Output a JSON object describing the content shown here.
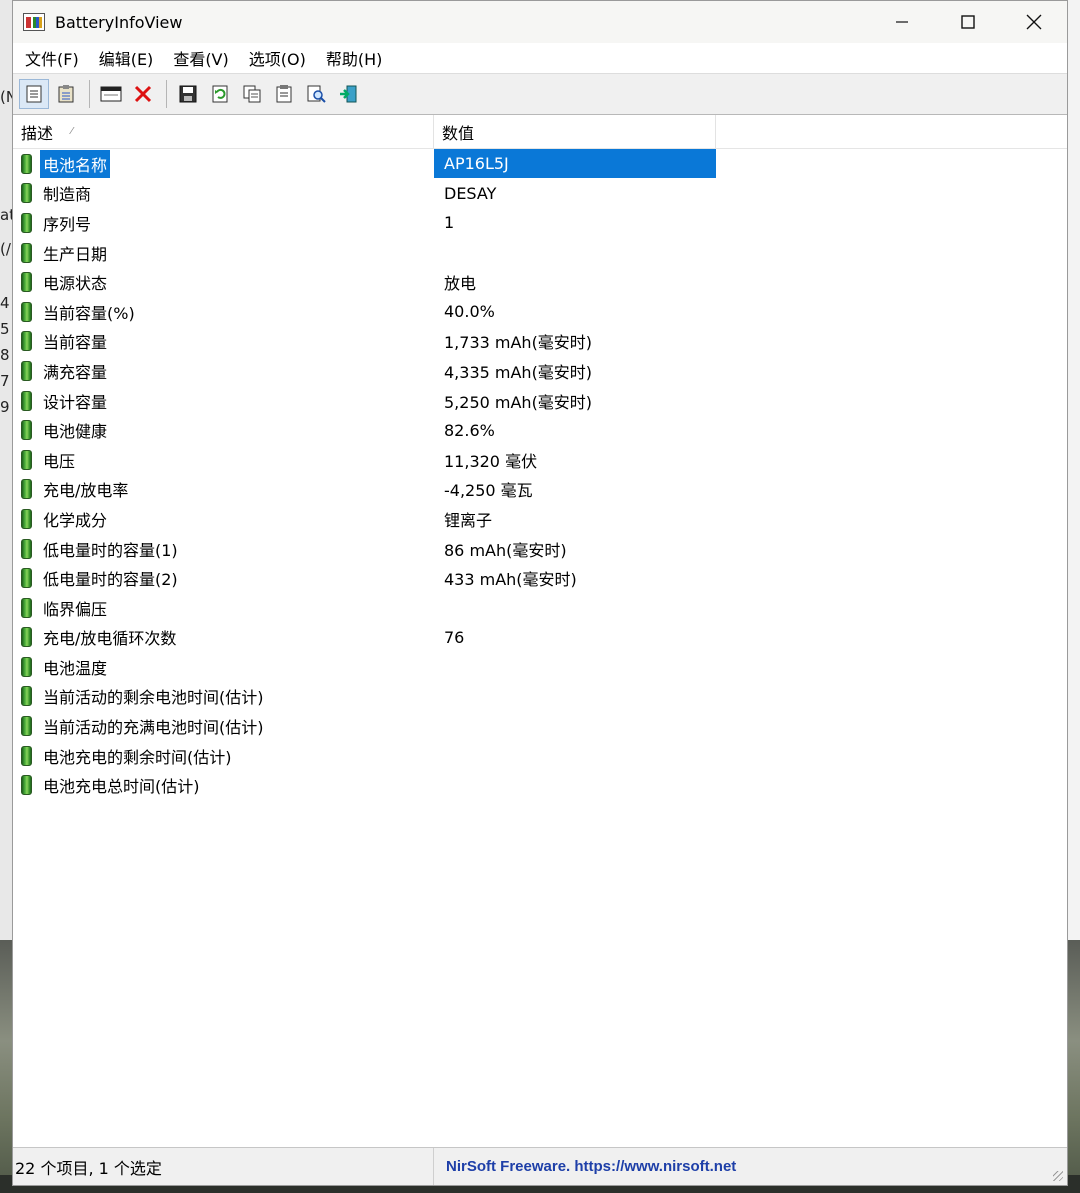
{
  "window": {
    "title": "BatteryInfoView"
  },
  "menu": [
    "文件(F)",
    "编辑(E)",
    "查看(V)",
    "选项(O)",
    "帮助(H)"
  ],
  "columns": [
    "描述",
    "数值"
  ],
  "rows": [
    {
      "label": "电池名称",
      "value": "AP16L5J"
    },
    {
      "label": "制造商",
      "value": "DESAY"
    },
    {
      "label": "序列号",
      "value": "1"
    },
    {
      "label": "生产日期",
      "value": ""
    },
    {
      "label": "电源状态",
      "value": "放电"
    },
    {
      "label": "当前容量(%)",
      "value": "40.0%"
    },
    {
      "label": "当前容量",
      "value": "1,733 mAh(毫安时)"
    },
    {
      "label": "满充容量",
      "value": "4,335 mAh(毫安时)"
    },
    {
      "label": "设计容量",
      "value": "5,250 mAh(毫安时)"
    },
    {
      "label": "电池健康",
      "value": "82.6%"
    },
    {
      "label": "电压",
      "value": "11,320 毫伏"
    },
    {
      "label": "充电/放电率",
      "value": "-4,250 毫瓦"
    },
    {
      "label": "化学成分",
      "value": "锂离子"
    },
    {
      "label": "低电量时的容量(1)",
      "value": "86 mAh(毫安时)"
    },
    {
      "label": "低电量时的容量(2)",
      "value": "433 mAh(毫安时)"
    },
    {
      "label": "临界偏压",
      "value": ""
    },
    {
      "label": "充电/放电循环次数",
      "value": "76"
    },
    {
      "label": "电池温度",
      "value": ""
    },
    {
      "label": "当前活动的剩余电池时间(估计)",
      "value": ""
    },
    {
      "label": "当前活动的充满电池时间(估计)",
      "value": ""
    },
    {
      "label": "电池充电的剩余时间(估计)",
      "value": ""
    },
    {
      "label": "电池充电总时间(估计)",
      "value": ""
    }
  ],
  "status": {
    "items": "22 个项目, 1 个选定",
    "link": "NirSoft Freeware. https://www.nirsoft.net"
  },
  "background_fragments": [
    "(N",
    "at",
    "(/",
    "4",
    "5",
    "8",
    "7",
    "9"
  ],
  "colors": {
    "selection": "#0a78d7",
    "link": "#1e3fa8"
  }
}
